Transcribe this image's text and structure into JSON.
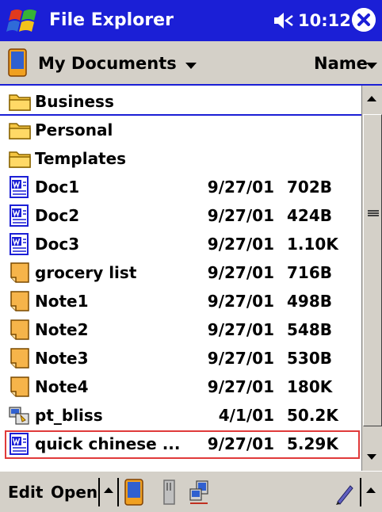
{
  "titlebar": {
    "app_title": "File Explorer",
    "time": "10:12",
    "start_icon": "windows-flag-icon",
    "speaker_icon": "speaker-icon",
    "close_icon": "close-icon"
  },
  "location": {
    "folder": "My Documents",
    "sort": "Name"
  },
  "files": [
    {
      "name": "Business",
      "date": "",
      "size": "",
      "icon": "folder-icon"
    },
    {
      "name": "Personal",
      "date": "",
      "size": "",
      "icon": "folder-icon"
    },
    {
      "name": "Templates",
      "date": "",
      "size": "",
      "icon": "folder-icon"
    },
    {
      "name": "Doc1",
      "date": "9/27/01",
      "size": "702B",
      "icon": "word-document-icon"
    },
    {
      "name": "Doc2",
      "date": "9/27/01",
      "size": "424B",
      "icon": "word-document-icon"
    },
    {
      "name": "Doc3",
      "date": "9/27/01",
      "size": "1.10K",
      "icon": "word-document-icon"
    },
    {
      "name": "grocery list",
      "date": "9/27/01",
      "size": "716B",
      "icon": "note-icon"
    },
    {
      "name": "Note1",
      "date": "9/27/01",
      "size": "498B",
      "icon": "note-icon"
    },
    {
      "name": "Note2",
      "date": "9/27/01",
      "size": "548B",
      "icon": "note-icon"
    },
    {
      "name": "Note3",
      "date": "9/27/01",
      "size": "530B",
      "icon": "note-icon"
    },
    {
      "name": "Note4",
      "date": "9/27/01",
      "size": "180K",
      "icon": "note-icon"
    },
    {
      "name": "pt_bliss",
      "date": "4/1/01",
      "size": "50.2K",
      "icon": "program-icon"
    },
    {
      "name": "quick chinese ...",
      "date": "9/27/01",
      "size": "5.29K",
      "icon": "word-document-icon"
    }
  ],
  "commandbar": {
    "edit": "Edit",
    "open": "Open"
  },
  "colors": {
    "titlebar_blue": "#1b1fd6",
    "chrome_gray": "#d4d0c8",
    "highlight_red": "#e03a3a"
  }
}
